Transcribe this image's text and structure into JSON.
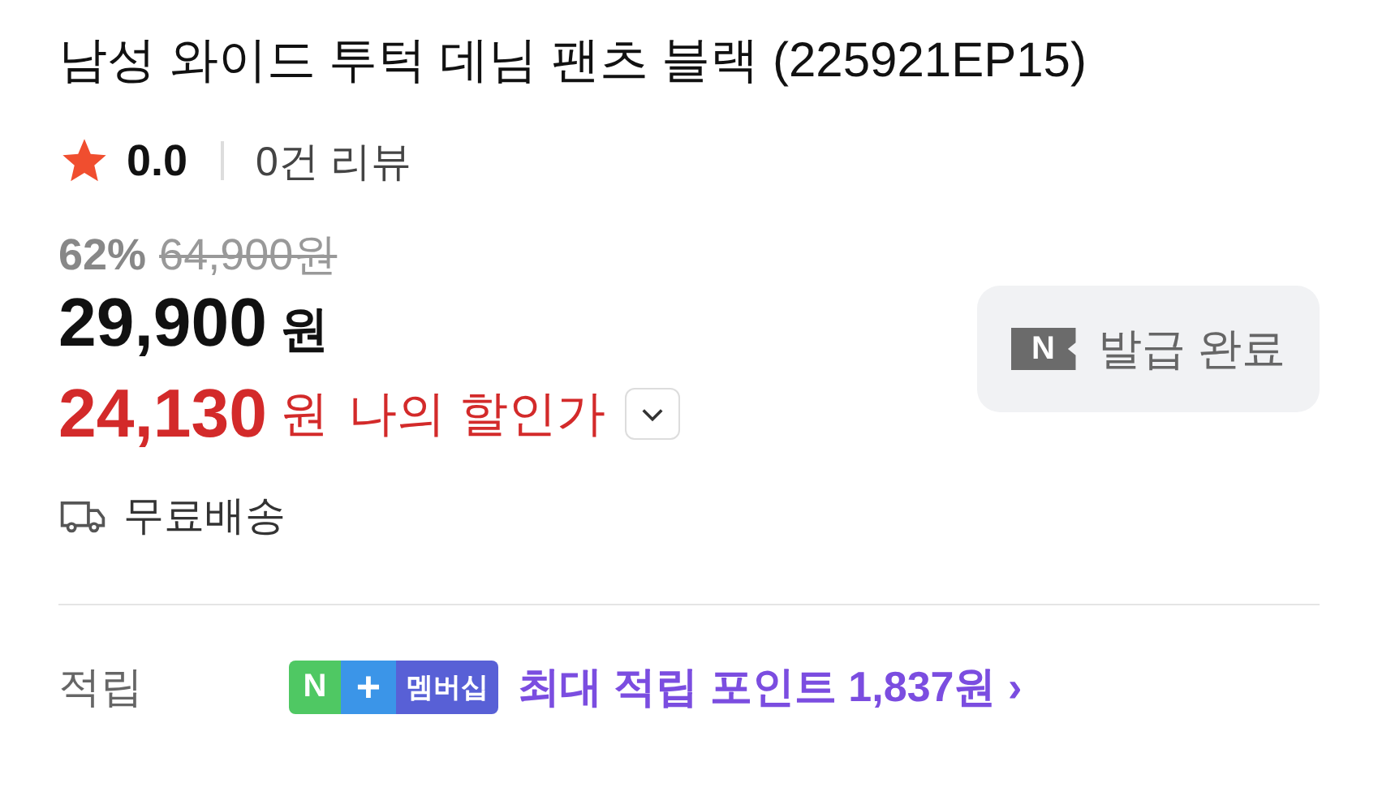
{
  "title": "남성 와이드 투턱 데님 팬츠 블랙 (225921EP15)",
  "rating": {
    "score": "0.0",
    "reviews": "0건 리뷰"
  },
  "price": {
    "discount": "62%",
    "original": "64,900원",
    "sale": "29,900",
    "sale_unit": "원",
    "my_price": "24,130",
    "my_unit": "원",
    "my_label": "나의 할인가",
    "expanded": false
  },
  "coupon": {
    "logo": "N",
    "label": "발급 완료",
    "issued": true
  },
  "shipping": "무료배송",
  "points": {
    "label": "적립",
    "badge": [
      "N",
      "+",
      "멤버십"
    ],
    "text": "최대 적립 포인트 1,837원",
    "arrow": "›"
  }
}
